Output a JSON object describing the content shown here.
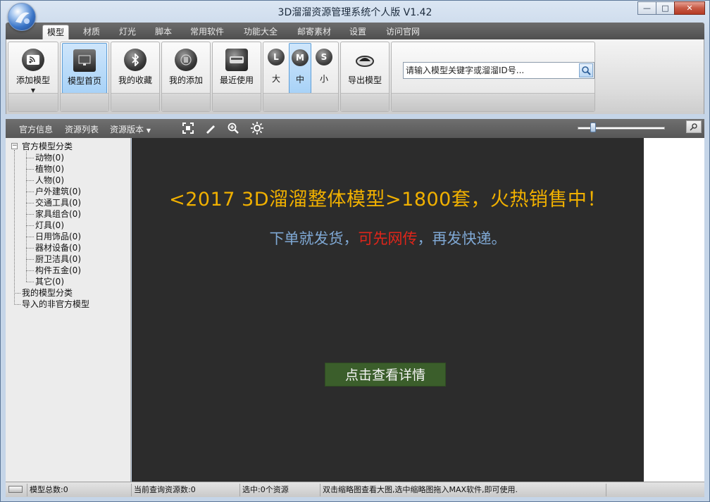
{
  "window": {
    "title": "3D溜溜资源管理系统个人版 V1.42",
    "controls": {
      "minimize": "—",
      "maximize": "□",
      "close": "✕"
    }
  },
  "tabs": [
    {
      "label": "模型",
      "active": true
    },
    {
      "label": "材质"
    },
    {
      "label": "灯光"
    },
    {
      "label": "脚本"
    },
    {
      "label": "常用软件"
    },
    {
      "label": "功能大全"
    },
    {
      "label": "邮寄素材"
    },
    {
      "label": "设置"
    },
    {
      "label": "访问官网"
    }
  ],
  "ribbon": {
    "add_model": "添加模型",
    "dropdown_arrow": "▼",
    "model_home": "模型首页",
    "my_favorites": "我的收藏",
    "my_added": "我的添加",
    "recent": "最近使用",
    "sizes": [
      {
        "badge": "L",
        "label": "大"
      },
      {
        "badge": "M",
        "label": "中",
        "active": true
      },
      {
        "badge": "S",
        "label": "小"
      }
    ],
    "export_model": "导出模型",
    "search_placeholder": "请输入模型关键字或溜溜ID号..."
  },
  "toolbar": {
    "official_info": "官方信息",
    "resource_list": "资源列表",
    "resource_version": "资源版本",
    "version_arrow": "▼"
  },
  "tree": {
    "expander": "−",
    "root_official": "官方模型分类",
    "children": [
      "动物(0)",
      "植物(0)",
      "人物(0)",
      "户外建筑(0)",
      "交通工具(0)",
      "家具组合(0)",
      "灯具(0)",
      "日用饰品(0)",
      "器材设备(0)",
      "厨卫洁具(0)",
      "构件五金(0)",
      "其它(0)"
    ],
    "my_categories": "我的模型分类",
    "imported": "导入的非官方模型"
  },
  "promo": {
    "headline": "<2017 3D溜溜整体模型>1800套，火热销售中！",
    "sub_part1": "下单就发货，",
    "sub_part2": "可先网传",
    "sub_part3": "，再发快递。",
    "button": "点击查看详情",
    "colors": {
      "headline": "#f0b000",
      "sub": "#7fa8d4",
      "highlight": "#e0251a",
      "button_bg": "#3b5e2b"
    }
  },
  "status": {
    "total_models": "模型总数:0",
    "current_query": "当前查询资源数:0",
    "selected": "选中:0个资源",
    "hint": "双击缩略图查看大图,选中缩略图拖入MAX软件,即可使用."
  }
}
